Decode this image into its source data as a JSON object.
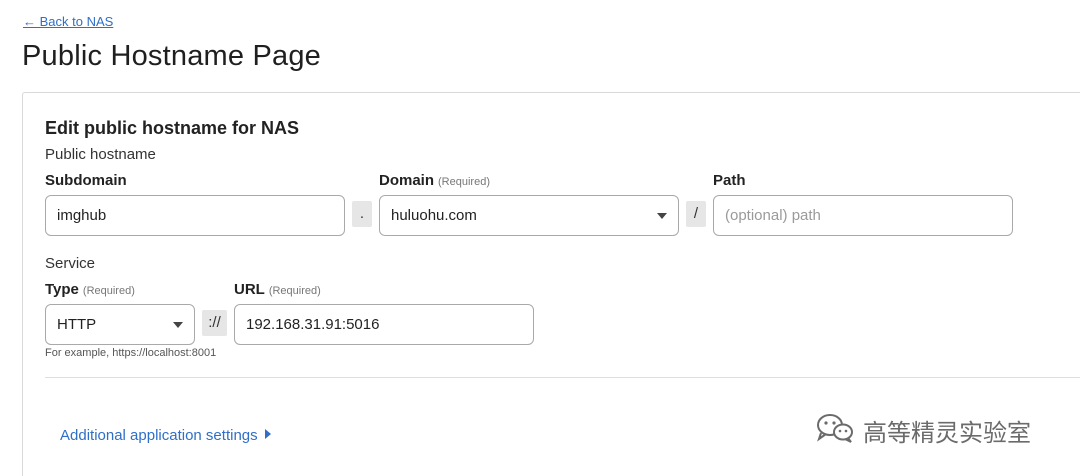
{
  "header": {
    "back_link": "← Back to NAS",
    "page_title": "Public Hostname Page"
  },
  "form": {
    "section_title": "Edit public hostname for NAS",
    "public_hostname_label": "Public hostname",
    "subdomain": {
      "label": "Subdomain",
      "value": "imghub"
    },
    "dot_separator": ".",
    "domain": {
      "label": "Domain",
      "required": "(Required)",
      "value": "huluohu.com"
    },
    "slash_separator": "/",
    "path": {
      "label": "Path",
      "placeholder": "(optional) path"
    },
    "service_label": "Service",
    "type": {
      "label": "Type",
      "required": "(Required)",
      "value": "HTTP"
    },
    "scheme_separator": "://",
    "url": {
      "label": "URL",
      "required": "(Required)",
      "value": "192.168.31.91:5016"
    },
    "hint": "For example, https://localhost:8001",
    "additional_settings": "Additional application settings"
  },
  "watermark": {
    "text": "高等精灵实验室",
    "icon": "wechat-icon"
  }
}
